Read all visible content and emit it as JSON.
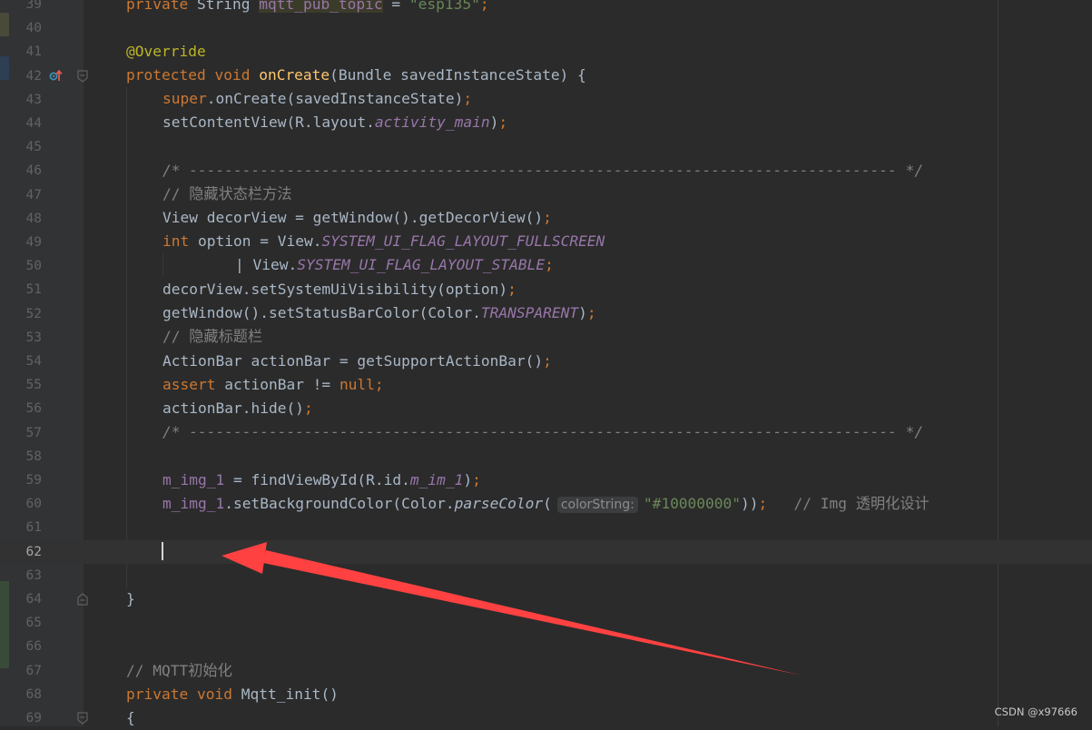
{
  "editor": {
    "current_line": "62",
    "lines": [
      {
        "n": "39"
      },
      {
        "n": "40"
      },
      {
        "n": "41"
      },
      {
        "n": "42"
      },
      {
        "n": "43"
      },
      {
        "n": "44"
      },
      {
        "n": "45"
      },
      {
        "n": "46"
      },
      {
        "n": "47"
      },
      {
        "n": "48"
      },
      {
        "n": "49"
      },
      {
        "n": "50"
      },
      {
        "n": "51"
      },
      {
        "n": "52"
      },
      {
        "n": "53"
      },
      {
        "n": "54"
      },
      {
        "n": "55"
      },
      {
        "n": "56"
      },
      {
        "n": "57"
      },
      {
        "n": "58"
      },
      {
        "n": "59"
      },
      {
        "n": "60"
      },
      {
        "n": "61"
      },
      {
        "n": "62"
      },
      {
        "n": "63"
      },
      {
        "n": "64"
      },
      {
        "n": "65"
      },
      {
        "n": "66"
      },
      {
        "n": "67"
      },
      {
        "n": "68"
      },
      {
        "n": "69"
      }
    ],
    "code": {
      "l39": {
        "kw": "private",
        "type": "String",
        "var": "mqtt_pub_topic",
        "op": "=",
        "str": "\"esp135\"",
        "semi": ";"
      },
      "l41": {
        "ann": "@Override"
      },
      "l42": {
        "kw1": "protected",
        "kw2": "void",
        "fn": "onCreate",
        "rest": "(Bundle savedInstanceState) {"
      },
      "l43": {
        "kw": "super",
        "rest": ".onCreate(savedInstanceState)",
        "semi": ";"
      },
      "l44": {
        "a": "setContentView(R.layout.",
        "fld": "activity_main",
        "b": ")",
        "semi": ";"
      },
      "l46": {
        "text": "/* -------------------------------------------------------------------------------- */"
      },
      "l47": {
        "text": "// 隐藏状态栏方法"
      },
      "l48": {
        "a": "View decorView = getWindow().getDecorView()",
        "semi": ";"
      },
      "l49": {
        "kw": "int",
        "a": " option = View.",
        "fld": "SYSTEM_UI_FLAG_LAYOUT_FULLSCREEN"
      },
      "l50": {
        "a": "| View.",
        "fld": "SYSTEM_UI_FLAG_LAYOUT_STABLE",
        "semi": ";"
      },
      "l51": {
        "a": "decorView.setSystemUiVisibility(option)",
        "semi": ";"
      },
      "l52": {
        "a": "getWindow().setStatusBarColor(Color.",
        "fld": "TRANSPARENT",
        "b": ")",
        "semi": ";"
      },
      "l53": {
        "text": "// 隐藏标题栏"
      },
      "l54": {
        "a": "ActionBar actionBar = getSupportActionBar()",
        "semi": ";"
      },
      "l55": {
        "kw": "assert",
        "a": " actionBar != ",
        "kw2": "null",
        "semi": ";"
      },
      "l56": {
        "a": "actionBar.hide()",
        "semi": ";"
      },
      "l57": {
        "text": "/* -------------------------------------------------------------------------------- */"
      },
      "l59": {
        "fld": "m_img_1",
        "a": " = findViewById(R.id.",
        "fld2": "m_im_1",
        "b": ")",
        "semi": ";"
      },
      "l60": {
        "fld": "m_img_1",
        "a": ".setBackgroundColor(Color.",
        "fn": "parseColor",
        "p": "(",
        "hint": "colorString:",
        "str": "\"#10000000\"",
        "b": "))",
        "semi": ";",
        "cm": "// Img 透明化设计"
      },
      "l64": {
        "text": "}"
      },
      "l67": {
        "text": "// MQTT初始化"
      },
      "l68": {
        "kw1": "private",
        "kw2": "void",
        "fn": "Mqtt_init",
        "rest": "()"
      },
      "l69": {
        "text": "{"
      }
    }
  },
  "watermark": "CSDN @x97666",
  "colors": {
    "background": "#2b2b2b",
    "gutter": "#313335",
    "keyword": "#cc7832",
    "string": "#6a8759",
    "field": "#9876aa",
    "method": "#ffc66d",
    "comment": "#808080",
    "annotation": "#bbb529",
    "arrow": "#ff4141"
  },
  "icons": {
    "override_marker": "override-method-icon",
    "fold_markers": "fold-marker-icon"
  }
}
